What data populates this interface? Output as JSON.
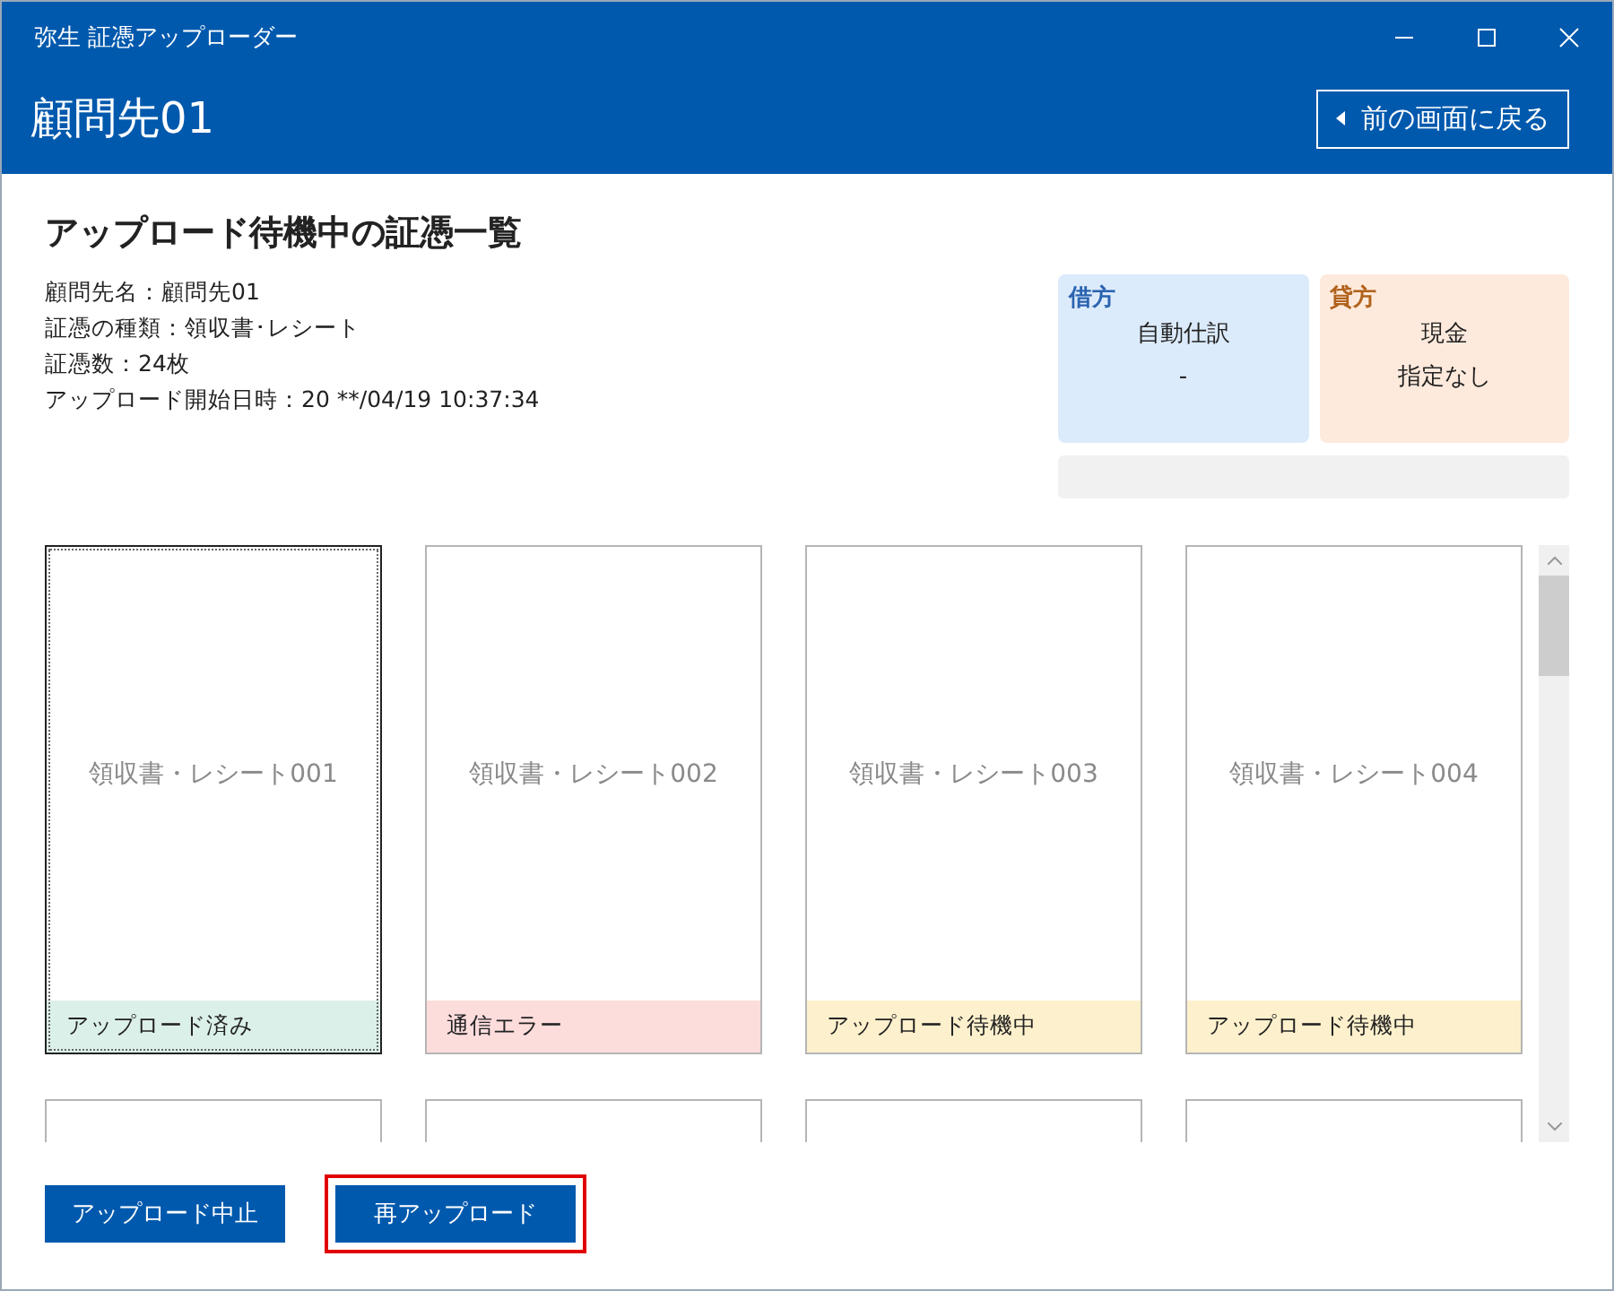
{
  "window": {
    "title": "弥生 証憑アップローダー"
  },
  "header": {
    "title": "顧問先01",
    "back_button": "前の画面に戻る"
  },
  "section_title": "アップロード待機中の証憑一覧",
  "info_lines": [
    "顧問先名：顧問先01",
    "証憑の種類：領収書･レシート",
    "証憑数：24枚",
    "アップロード開始日時：20 **/04/19 10:37:34"
  ],
  "journal": [
    {
      "kind": "debit",
      "heading": "借方",
      "lines": [
        "自動仕訳",
        "-"
      ]
    },
    {
      "kind": "credit",
      "heading": "貸方",
      "lines": [
        "現金",
        "指定なし"
      ]
    }
  ],
  "cards": [
    {
      "label": "領収書・レシート001",
      "status": "アップロード済み",
      "kind": "done",
      "selected": true
    },
    {
      "label": "領収書・レシート002",
      "status": "通信エラー",
      "kind": "error",
      "selected": false
    },
    {
      "label": "領収書・レシート003",
      "status": "アップロード待機中",
      "kind": "waiting",
      "selected": false
    },
    {
      "label": "領収書・レシート004",
      "status": "アップロード待機中",
      "kind": "waiting",
      "selected": false
    }
  ],
  "buttons": [
    {
      "label": "アップロード中止",
      "highlighted": false
    },
    {
      "label": "再アップロード",
      "highlighted": true
    }
  ]
}
